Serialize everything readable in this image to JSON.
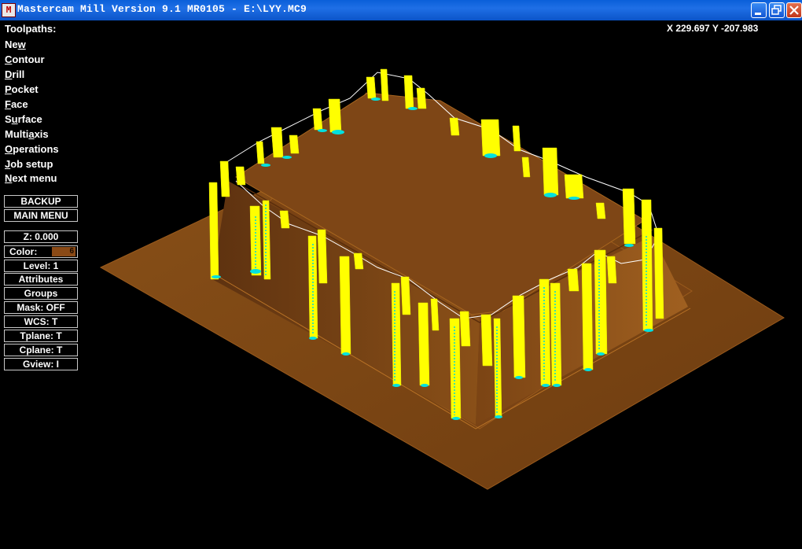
{
  "window": {
    "app_icon_glyph": "M",
    "title": "Mastercam Mill Version 9.1 MR0105 - E:\\LYY.MC9",
    "icon_names": {
      "minimize": "minimize-icon",
      "maximize": "restore-icon",
      "close": "close-icon"
    }
  },
  "coordinates": "X 229.697  Y -207.983",
  "menu": {
    "title": "Toolpaths:",
    "items": [
      {
        "pre": "Ne",
        "key": "w",
        "post": ""
      },
      {
        "pre": "",
        "key": "C",
        "post": "ontour"
      },
      {
        "pre": "",
        "key": "D",
        "post": "rill"
      },
      {
        "pre": "",
        "key": "P",
        "post": "ocket"
      },
      {
        "pre": "",
        "key": "F",
        "post": "ace"
      },
      {
        "pre": "S",
        "key": "u",
        "post": "rface"
      },
      {
        "pre": "Multi",
        "key": "a",
        "post": "xis"
      },
      {
        "pre": "",
        "key": "O",
        "post": "perations"
      },
      {
        "pre": "",
        "key": "J",
        "post": "ob setup"
      },
      {
        "pre": "",
        "key": "N",
        "post": "ext menu"
      }
    ]
  },
  "panel": {
    "backup": "BACKUP",
    "main_menu": "MAIN MENU",
    "z": "Z:  0.000",
    "color_label": "Color:",
    "color_value": "6",
    "level": "Level:  1",
    "attributes": "Attributes",
    "groups": "Groups",
    "mask": "Mask:  OFF",
    "wcs": "WCS:  T",
    "tplane": "Tplane:  T",
    "cplane": "Cplane:  T",
    "gview": "Gview:  I"
  },
  "colors": {
    "background": "#000000",
    "part": "#7a4414",
    "part_edge": "#a8661f",
    "toolpath": "#ffff00",
    "tool_marks": "#00e0e0",
    "link_lines": "#ffffff",
    "titlebar": "#0a5fd9"
  }
}
